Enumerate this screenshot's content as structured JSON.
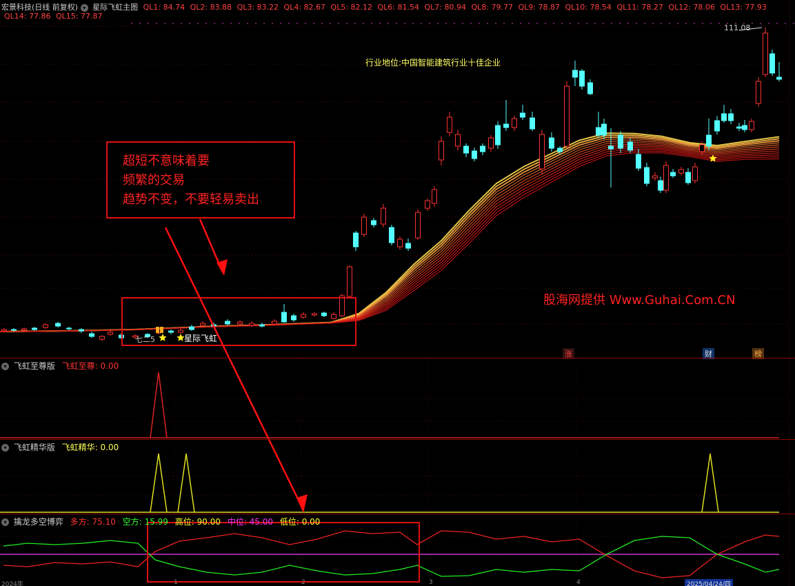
{
  "header": {
    "stock_title": "宏景科技(日线 前复权)",
    "indicator_name": "星际飞虹主图",
    "ql_values": [
      "QL1: 84.74",
      "QL2: 83.88",
      "QL3: 83.22",
      "QL4: 82.67",
      "QL5: 82.12",
      "QL6: 81.54",
      "QL7: 80.94",
      "QL8: 79.77",
      "QL9: 78.87",
      "QL10: 78.54",
      "QL11: 78.27",
      "QL12: 78.06",
      "QL13: 77.93",
      "QL14: 77.86",
      "QL15: 77.87"
    ]
  },
  "main_chart": {
    "price_high_label": "111.08",
    "industry_label": "行业地位:中国智能建筑行业十佳企业",
    "watermark": "股海网提供 Www.Guhai.Com.CN",
    "annotation_lines": [
      "超短不意味着要",
      "频繁的交易",
      "趋势不变，不要轻易卖出"
    ],
    "star_label": "星际飞虹",
    "small_label": "七二5",
    "event_tags": [
      "涨",
      "财",
      "榜"
    ],
    "colors": {
      "up": "#ff3232",
      "down": "#54ffff",
      "ribbon_hot": "#ffdd55",
      "ribbon_cool": "#cc1111",
      "annotation": "#ff2222"
    }
  },
  "pane1": {
    "name": "飞虹至尊版",
    "series_label": "飞虹至尊: 0.00"
  },
  "pane2": {
    "name": "飞虹精华版",
    "series_label": "飞虹精华: 0.00"
  },
  "pane3": {
    "name": "擒龙多空博弈",
    "bull": "多方: 75.10",
    "bear": "空方: 15.99",
    "high": "高位: 90.00",
    "mid": "中位: 45.00",
    "low": "低位: 0.00"
  },
  "date_axis": {
    "first": "2024年",
    "labels": [
      "1",
      "2",
      "3",
      "4"
    ],
    "cursor_date": "2025/04/24/四"
  }
}
